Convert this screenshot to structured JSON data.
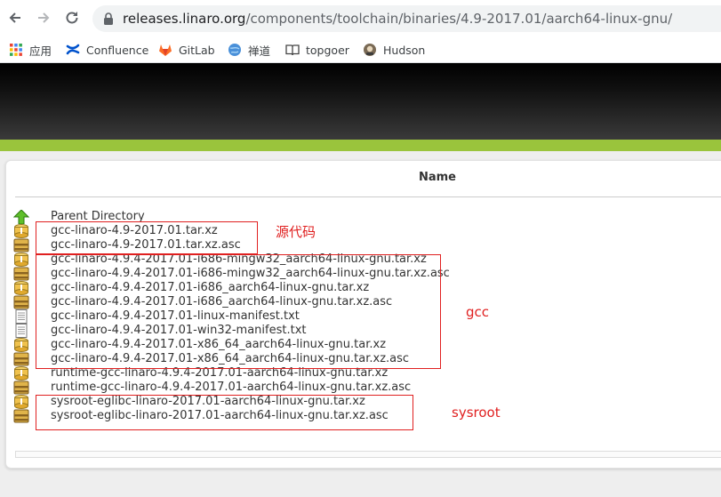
{
  "browser": {
    "url_host": "releases.linaro.org",
    "url_path": "/components/toolchain/binaries/4.9-2017.01/aarch64-linux-gnu/",
    "bookmarks": [
      {
        "label": "应用",
        "icon": "apps-grid-icon"
      },
      {
        "label": "Confluence",
        "icon": "confluence-icon"
      },
      {
        "label": "GitLab",
        "icon": "gitlab-icon"
      },
      {
        "label": "禅道",
        "icon": "zentao-globe-icon"
      },
      {
        "label": "topgoer",
        "icon": "book-icon"
      },
      {
        "label": "Hudson",
        "icon": "hudson-icon"
      }
    ]
  },
  "colors": {
    "accent_green": "#9ac43c",
    "annotation_red": "#e02020",
    "link_text": "#333333"
  },
  "listing": {
    "column_header": "Name",
    "parent": {
      "label": "Parent Directory",
      "icon": "up-arrow-icon"
    },
    "files": [
      {
        "name": "gcc-linaro-4.9-2017.01.tar.xz",
        "icon": "compressed-file-icon"
      },
      {
        "name": "gcc-linaro-4.9-2017.01.tar.xz.asc",
        "icon": "archive-box-icon"
      },
      {
        "name": "gcc-linaro-4.9.4-2017.01-i686-mingw32_aarch64-linux-gnu.tar.xz",
        "icon": "compressed-file-icon"
      },
      {
        "name": "gcc-linaro-4.9.4-2017.01-i686-mingw32_aarch64-linux-gnu.tar.xz.asc",
        "icon": "archive-box-icon"
      },
      {
        "name": "gcc-linaro-4.9.4-2017.01-i686_aarch64-linux-gnu.tar.xz",
        "icon": "compressed-file-icon"
      },
      {
        "name": "gcc-linaro-4.9.4-2017.01-i686_aarch64-linux-gnu.tar.xz.asc",
        "icon": "archive-box-icon"
      },
      {
        "name": "gcc-linaro-4.9.4-2017.01-linux-manifest.txt",
        "icon": "text-file-icon"
      },
      {
        "name": "gcc-linaro-4.9.4-2017.01-win32-manifest.txt",
        "icon": "text-file-icon"
      },
      {
        "name": "gcc-linaro-4.9.4-2017.01-x86_64_aarch64-linux-gnu.tar.xz",
        "icon": "compressed-file-icon"
      },
      {
        "name": "gcc-linaro-4.9.4-2017.01-x86_64_aarch64-linux-gnu.tar.xz.asc",
        "icon": "archive-box-icon"
      },
      {
        "name": "runtime-gcc-linaro-4.9.4-2017.01-aarch64-linux-gnu.tar.xz",
        "icon": "compressed-file-icon"
      },
      {
        "name": "runtime-gcc-linaro-4.9.4-2017.01-aarch64-linux-gnu.tar.xz.asc",
        "icon": "archive-box-icon"
      },
      {
        "name": "sysroot-eglibc-linaro-2017.01-aarch64-linux-gnu.tar.xz",
        "icon": "compressed-file-icon"
      },
      {
        "name": "sysroot-eglibc-linaro-2017.01-aarch64-linux-gnu.tar.xz.asc",
        "icon": "archive-box-icon"
      }
    ]
  },
  "annotations": [
    {
      "label": "源代码"
    },
    {
      "label": "gcc"
    },
    {
      "label": "sysroot"
    }
  ]
}
